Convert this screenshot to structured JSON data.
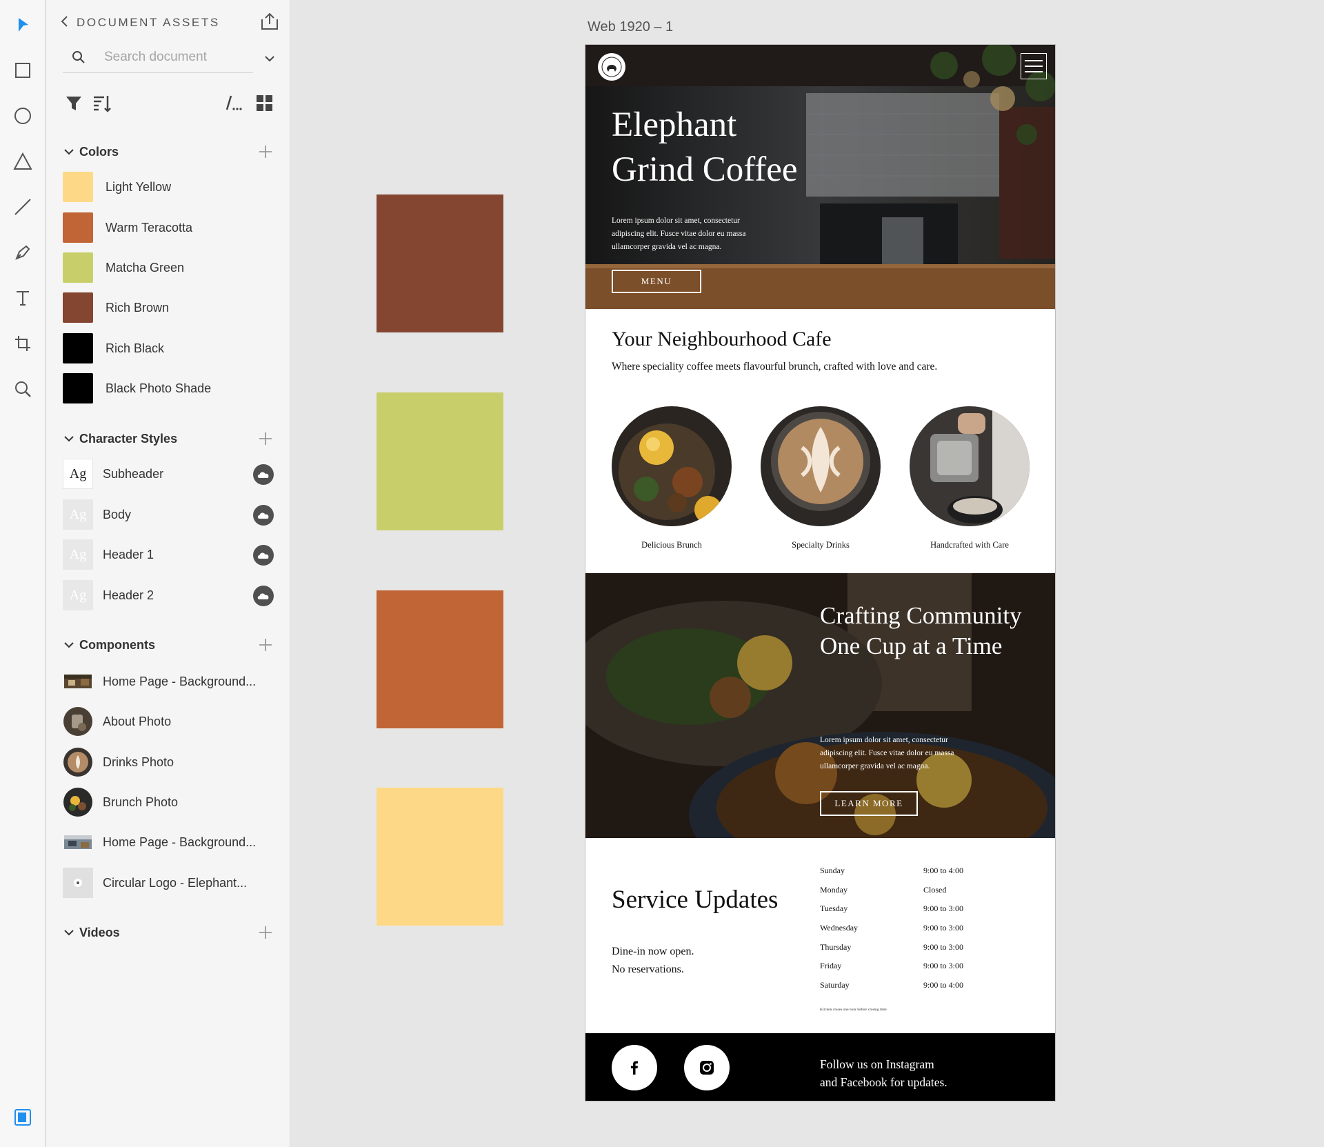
{
  "assets_panel": {
    "title": "DOCUMENT ASSETS",
    "search_placeholder": "Search document",
    "colors_section": "Colors",
    "colors": [
      {
        "name": "Light Yellow",
        "hex": "#fdd987"
      },
      {
        "name": "Warm Teracotta",
        "hex": "#c26536"
      },
      {
        "name": "Matcha Green",
        "hex": "#c8cf6a"
      },
      {
        "name": "Rich Brown",
        "hex": "#844531"
      },
      {
        "name": "Rich Black",
        "hex": "#000000"
      },
      {
        "name": "Black Photo Shade",
        "hex": "#000000"
      }
    ],
    "char_styles_section": "Character Styles",
    "char_styles": [
      {
        "sample": "Ag",
        "name": "Subheader"
      },
      {
        "sample": "Ag",
        "name": "Body"
      },
      {
        "sample": "Ag",
        "name": "Header 1"
      },
      {
        "sample": "Ag",
        "name": "Header 2"
      }
    ],
    "components_section": "Components",
    "components": [
      {
        "name": "Home Page - Background..."
      },
      {
        "name": "About Photo"
      },
      {
        "name": "Drinks Photo"
      },
      {
        "name": "Brunch Photo"
      },
      {
        "name": "Home Page - Background..."
      },
      {
        "name": "Circular Logo - Elephant..."
      }
    ],
    "videos_section": "Videos"
  },
  "canvas_swatches": [
    "#844531",
    "#c8cf6a",
    "#c26536",
    "#fdd987"
  ],
  "artboard": {
    "name": "Web 1920 – 1",
    "hero": {
      "title_line1": "Elephant",
      "title_line2": "Grind Coffee",
      "lorem": "Lorem ipsum dolor sit amet, consectetur adipiscing elit. Fusce vitae dolor eu massa ullamcorper gravida vel ac magna.",
      "menu_button": "MENU"
    },
    "intro": {
      "title": "Your Neighbourhood Cafe",
      "subtitle": "Where speciality coffee meets flavourful brunch, crafted with love and care.",
      "features": [
        "Delicious Brunch",
        "Specialty Drinks",
        "Handcrafted with Care"
      ]
    },
    "community": {
      "title": "Crafting Community One Cup at a Time",
      "lorem": "Lorem ipsum dolor sit amet, consectetur adipiscing elit. Fusce vitae dolor eu massa ullamcorper gravida vel ac magna.",
      "button": "LEARN MORE"
    },
    "service": {
      "title": "Service Updates",
      "note_line1": "Dine-in now open.",
      "note_line2": "No reservations.",
      "hours": [
        {
          "day": "Sunday",
          "time": "9:00 to 4:00"
        },
        {
          "day": "Monday",
          "time": "Closed"
        },
        {
          "day": "Tuesday",
          "time": "9:00 to 3:00"
        },
        {
          "day": "Wednesday",
          "time": "9:00 to 3:00"
        },
        {
          "day": "Thursday",
          "time": "9:00 to 3:00"
        },
        {
          "day": "Friday",
          "time": "9:00 to 3:00"
        },
        {
          "day": "Saturday",
          "time": "9:00 to 4:00"
        }
      ],
      "kitchen_note": "Kitchen closes one hour before closing time"
    },
    "footer": {
      "follow_line1": "Follow us on Instagram",
      "follow_line2": "and Facebook for updates."
    }
  }
}
